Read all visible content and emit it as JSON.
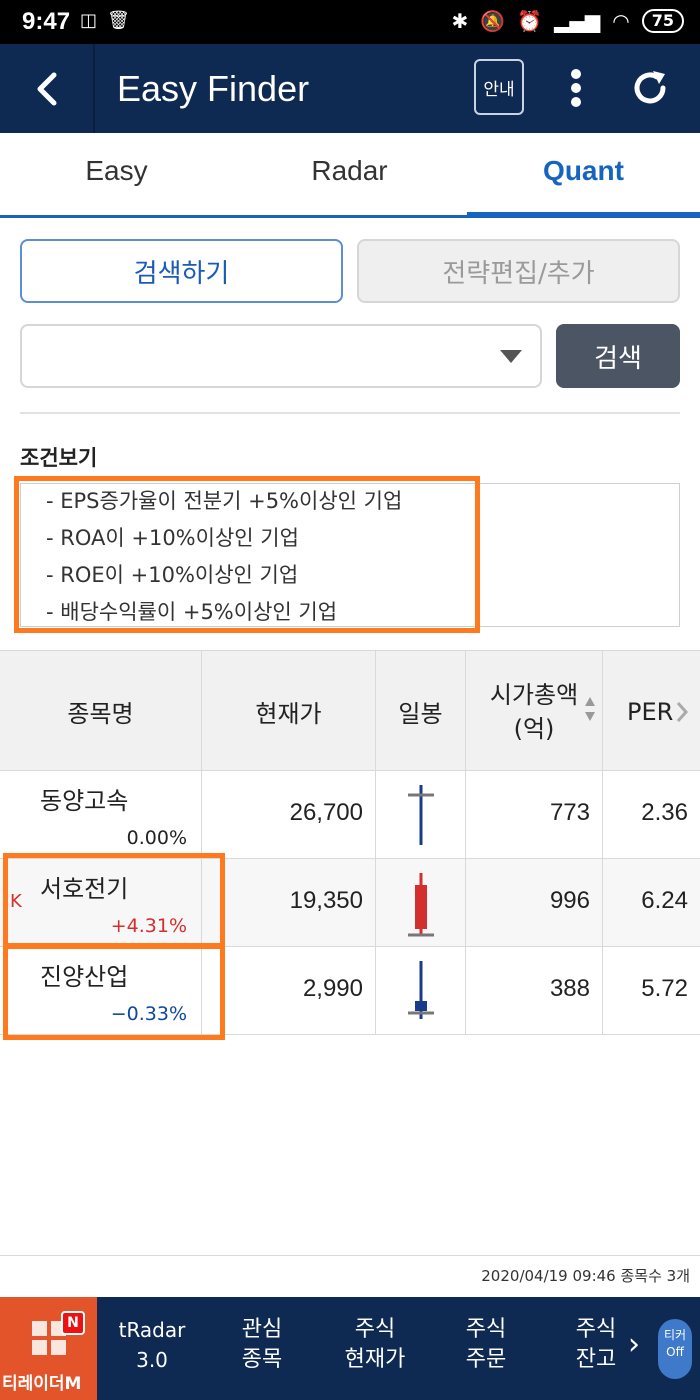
{
  "status_bar": {
    "time": "9:47",
    "battery": "75"
  },
  "app_bar": {
    "title": "Easy Finder",
    "guide_label": "안내"
  },
  "tabs": [
    {
      "label": "Easy",
      "active": false
    },
    {
      "label": "Radar",
      "active": false
    },
    {
      "label": "Quant",
      "active": true
    }
  ],
  "actions": {
    "search_mode_label": "검색하기",
    "strategy_label": "전략편집/추가"
  },
  "search": {
    "selected_value": "",
    "button_label": "검색"
  },
  "conditions": {
    "title": "조건보기",
    "items": [
      "- EPS증가율이 전분기 +5%이상인 기업",
      "- ROA이 +10%이상인 기업",
      "- ROE이 +10%이상인 기업",
      "- 배당수익률이 +5%이상인 기업"
    ]
  },
  "table": {
    "headers": {
      "name": "종목명",
      "price": "현재가",
      "candle": "일봉",
      "mktcap_line1": "시가총액",
      "mktcap_line2": "(억)",
      "per": "PER"
    },
    "rows": [
      {
        "name": "동양고속",
        "rate": "0.00%",
        "price": "26,700",
        "mktcap": "773",
        "per": "2.36",
        "marker": ""
      },
      {
        "name": "서호전기",
        "rate": "+4.31%",
        "price": "19,350",
        "mktcap": "996",
        "per": "6.24",
        "marker": "K"
      },
      {
        "name": "진양산업",
        "rate": "−0.33%",
        "price": "2,990",
        "mktcap": "388",
        "per": "5.72",
        "marker": ""
      }
    ]
  },
  "footer": {
    "info": "2020/04/19 09:46 종목수 3개"
  },
  "bottom_nav": {
    "logo_label": "티레이더M",
    "badge": "N",
    "items": [
      {
        "line1": "tRadar",
        "line2": "3.0"
      },
      {
        "line1": "관심",
        "line2": "종목"
      },
      {
        "line1": "주식",
        "line2": "현재가"
      },
      {
        "line1": "주식",
        "line2": "주문"
      },
      {
        "line1": "주식",
        "line2": "잔고"
      }
    ],
    "ticker_line1": "티커",
    "ticker_line2": "Off"
  },
  "colors": {
    "navy": "#0f2a52",
    "accent_blue": "#1565c0",
    "up_red": "#d32f2f",
    "down_blue": "#0d47a1",
    "highlight_orange": "#ff7a1f"
  }
}
